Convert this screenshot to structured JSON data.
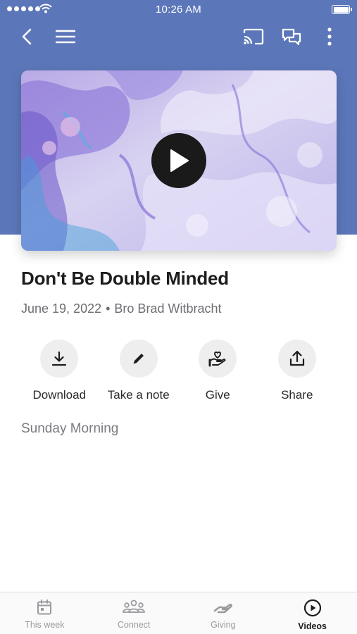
{
  "status_bar": {
    "time": "10:26 AM"
  },
  "nav": {
    "icons": [
      "back-chevron-icon",
      "menu-icon",
      "cast-icon",
      "chat-icon",
      "more-vertical-icon"
    ]
  },
  "video": {
    "play_icon": "play-icon"
  },
  "sermon": {
    "title": "Don't Be Double Minded",
    "date": "June 19, 2022",
    "separator": "•",
    "speaker": "Bro Brad Witbracht",
    "series": "Sunday Morning"
  },
  "actions": [
    {
      "label": "Download",
      "icon": "download-icon"
    },
    {
      "label": "Take a note",
      "icon": "pencil-icon"
    },
    {
      "label": "Give",
      "icon": "give-heart-hand-icon"
    },
    {
      "label": "Share",
      "icon": "share-icon"
    }
  ],
  "tabs": [
    {
      "label": "This week",
      "icon": "calendar-icon",
      "active": false
    },
    {
      "label": "Connect",
      "icon": "people-icon",
      "active": false
    },
    {
      "label": "Giving",
      "icon": "giving-hand-icon",
      "active": false
    },
    {
      "label": "Videos",
      "icon": "play-circle-icon",
      "active": true
    }
  ],
  "colors": {
    "header": "#5c77b9",
    "active_tab": "#1d1d1f",
    "inactive_tab": "#9a9a9f"
  }
}
